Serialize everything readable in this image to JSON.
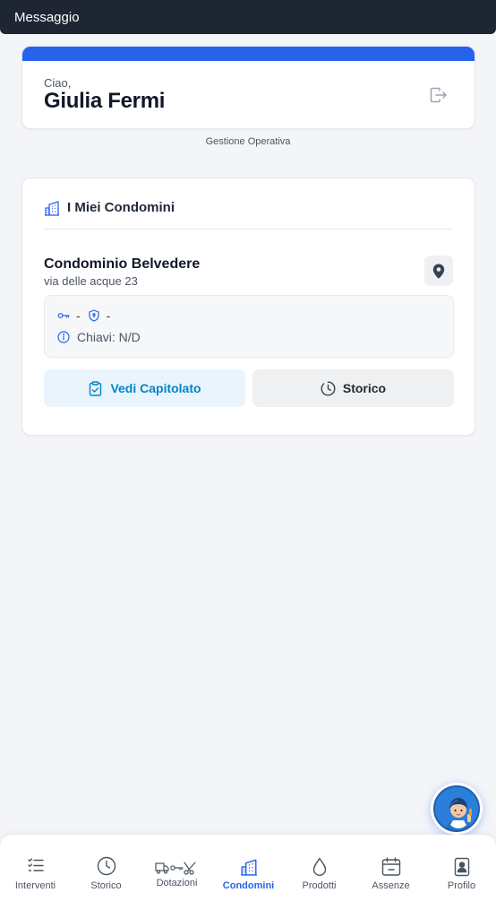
{
  "topbar": {
    "title": "Messaggio"
  },
  "greeting": {
    "hello": "Ciao,",
    "name": "Giulia Fermi"
  },
  "role": "Gestione Operativa",
  "section": {
    "title": "I Miei Condomini"
  },
  "condo": {
    "name": "Condominio Belvedere",
    "address": "via delle acque 23",
    "key_value": "-",
    "alarm_value": "-",
    "keys_info": "Chiavi: N/D"
  },
  "actions": {
    "capitolato": "Vedi Capitolato",
    "storico": "Storico"
  },
  "nav": {
    "items": [
      {
        "label": "Interventi",
        "icon": "list-check-icon"
      },
      {
        "label": "Storico",
        "icon": "clock-icon"
      },
      {
        "label": "Dotazioni",
        "icon": "truck-key-scissors-icon"
      },
      {
        "label": "Condomini",
        "icon": "buildings-icon",
        "active": true
      },
      {
        "label": "Prodotti",
        "icon": "drop-icon"
      },
      {
        "label": "Assenze",
        "icon": "calendar-icon"
      },
      {
        "label": "Profilo",
        "icon": "badge-icon"
      }
    ]
  },
  "colors": {
    "accent": "#2563eb",
    "topbar": "#1e2533",
    "link": "#0284c7"
  }
}
